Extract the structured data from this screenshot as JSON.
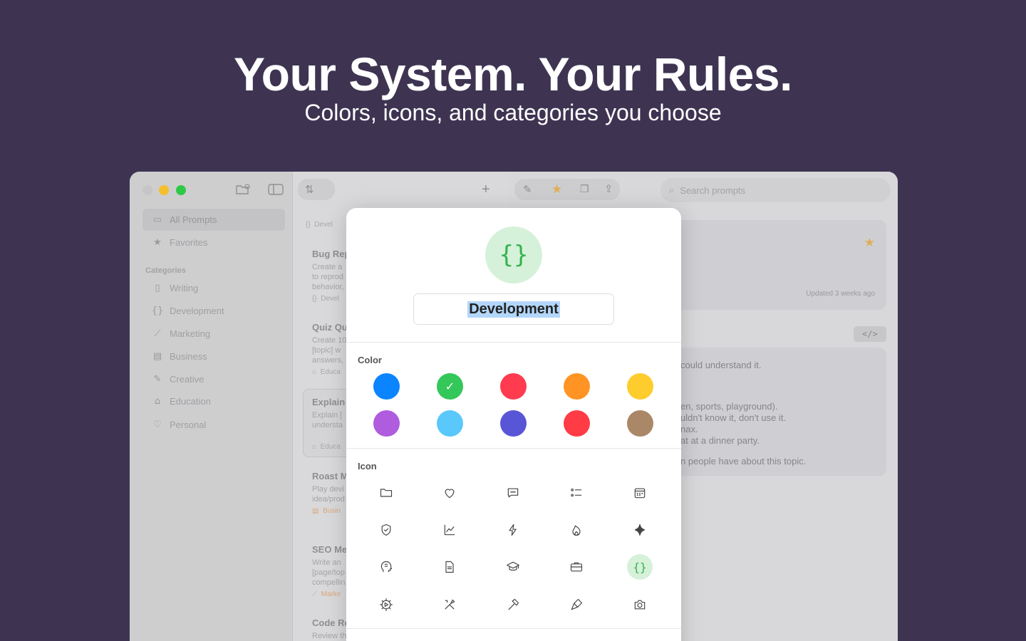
{
  "hero": {
    "title": "Your System. Your Rules.",
    "subtitle": "Colors, icons, and categories you choose"
  },
  "sidebar": {
    "items": [
      {
        "label": "All Prompts",
        "icon": "folder-icon"
      },
      {
        "label": "Favorites",
        "icon": "star-icon"
      }
    ],
    "categories_header": "Categories",
    "categories": [
      {
        "label": "Writing",
        "icon": "document-icon"
      },
      {
        "label": "Development",
        "icon": "braces-icon"
      },
      {
        "label": "Marketing",
        "icon": "chart-icon"
      },
      {
        "label": "Business",
        "icon": "briefcase-icon"
      },
      {
        "label": "Creative",
        "icon": "brush-icon"
      },
      {
        "label": "Education",
        "icon": "graduation-cap-icon"
      },
      {
        "label": "Personal",
        "icon": "heart-icon"
      }
    ]
  },
  "list": {
    "top_tag": "Devel",
    "cards": [
      {
        "title": "Bug Rep",
        "desc": [
          "Create a",
          "to reprod",
          "behavior,"
        ],
        "tag": "Devel"
      },
      {
        "title": "Quiz Qu",
        "desc": [
          "Create 10",
          "[topic] w",
          "answers,"
        ],
        "tag": "Educa"
      },
      {
        "title": "Explain",
        "desc": [
          "Explain [",
          "understa"
        ],
        "tag": "Educa"
      },
      {
        "title": "Roast M",
        "desc": [
          "Play devi",
          "idea/prod"
        ],
        "tag": "Busin"
      },
      {
        "title": "SEO Me",
        "desc": [
          "Write an",
          "[page/top",
          "compellin"
        ],
        "tag": "Marke"
      },
      {
        "title": "Code Re",
        "desc": [
          "Review th"
        ],
        "tag": ""
      }
    ]
  },
  "search": {
    "placeholder": "Search prompts"
  },
  "detail": {
    "updated": "Updated 3 weeks ago",
    "lines": [
      "could understand it.",
      "en, sports, playground).",
      "uldn't know it, don't use it.",
      "nax.",
      "at at a dinner party.",
      "n people have about this topic."
    ]
  },
  "modal": {
    "badge_glyph": "{}",
    "name_value": "Development",
    "color_label": "Color",
    "icon_label": "Icon",
    "colors": [
      "#0a84ff",
      "#34c759",
      "#ff3b4f",
      "#ff9424",
      "#ffcc2e",
      "#af5cdf",
      "#5ac8fa",
      "#5856d6",
      "#ff3b46",
      "#a98767"
    ],
    "selected_color": "#34c759",
    "check_glyph": "✓",
    "icons": [
      "folder-icon",
      "heart-icon",
      "speech-bubble-icon",
      "checklist-icon",
      "calendar-icon",
      "shield-check-icon",
      "chart-icon",
      "bolt-icon",
      "flame-icon",
      "sparkle-icon",
      "brain-head-icon",
      "document-icon",
      "graduation-cap-icon",
      "briefcase-icon",
      "braces-icon",
      "gear-play-icon",
      "tools-icon",
      "hammer-icon",
      "paintbrush-icon",
      "camera-icon"
    ],
    "selected_icon": "braces-icon"
  }
}
